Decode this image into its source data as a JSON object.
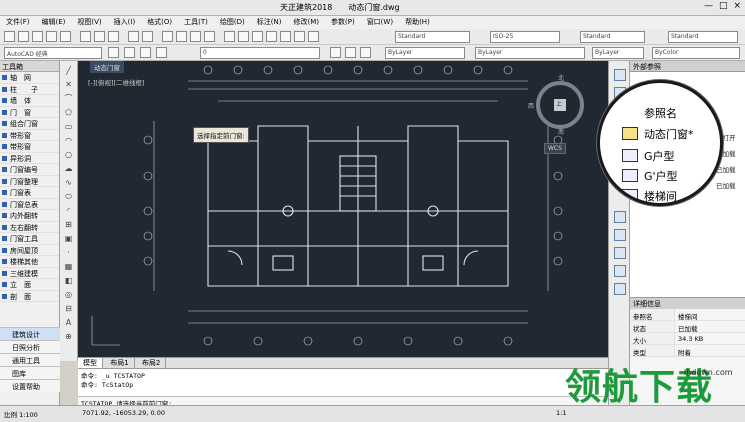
{
  "window": {
    "app_title": "天正建筑2018",
    "doc_title": "动态门窗.dwg",
    "buttons": [
      "—",
      "□",
      "×"
    ]
  },
  "menu": [
    "文件(F)",
    "编辑(E)",
    "视图(V)",
    "插入(I)",
    "格式(O)",
    "工具(T)",
    "绘图(D)",
    "标注(N)",
    "修改(M)",
    "参数(P)",
    "窗口(W)",
    "帮助(H)"
  ],
  "toolbar": {
    "workspace": "AutoCAD 经典",
    "layer": "0",
    "textstyle": "Standard",
    "dimstyle": "ISO-25",
    "tablestyle": "Standard",
    "mleaderstyle": "Standard",
    "color": "ByLayer",
    "linetype": "ByLayer",
    "lineweight": "ByLayer",
    "plotstyle": "ByColor"
  },
  "left_panel": {
    "title": "工具箱",
    "items": [
      "轴　网",
      "柱　　子",
      "墙　体",
      "门　窗",
      "组合门窗",
      "带形窗",
      "带形窗",
      "异形洞",
      "门窗编号",
      "门窗整理",
      "门窗表",
      "门窗总表",
      "内外翻转",
      "左右翻转",
      "门窗工具",
      "房间屋顶",
      "楼梯其他",
      "三维建模",
      "立　面",
      "剖　面"
    ],
    "bottom": [
      "建筑设计",
      "日照分析",
      "通用工具",
      "图库",
      "设置帮助"
    ]
  },
  "canvas": {
    "viewport_tab": "动态门窗",
    "view_info": "[-][俯视][二维线框]",
    "tooltip": "选择指定前门窗:",
    "compass": {
      "north": "北",
      "west": "西",
      "south": "南",
      "center": "上"
    },
    "wcs": "WCS"
  },
  "layout_tabs": [
    "模型",
    "布局1",
    "布局2"
  ],
  "command": {
    "history": [
      "命令: _u TCSTATOP",
      "命令: TcStatOp"
    ],
    "prompt": "TCSTATOP 请选择当前前门窗:"
  },
  "status": {
    "scale": "比例 1:100",
    "coords": "7071.92, -16053.29, 0.00",
    "annotation": "1:1"
  },
  "right_panel": {
    "title": "外部参照",
    "tree_status": [
      "已打开",
      "已加载",
      "已加载",
      "已加载"
    ],
    "detail_title": "详细信息",
    "details": [
      {
        "k": "参照名",
        "v": "楼梯间"
      },
      {
        "k": "状态",
        "v": "已加载"
      },
      {
        "k": "大小",
        "v": "34.3 KB"
      },
      {
        "k": "类型",
        "v": "附着"
      }
    ]
  },
  "magnifier": {
    "header": "参照名",
    "items": [
      "动态门窗*",
      "G户型",
      "G'户型",
      "楼梯间"
    ]
  },
  "watermark": {
    "text": "领航下载",
    "url": "lhdown.com"
  },
  "colors": {
    "canvas_bg": "#222831",
    "drawing_line": "#c9ccd4",
    "watermark": "#1d9a3a"
  }
}
